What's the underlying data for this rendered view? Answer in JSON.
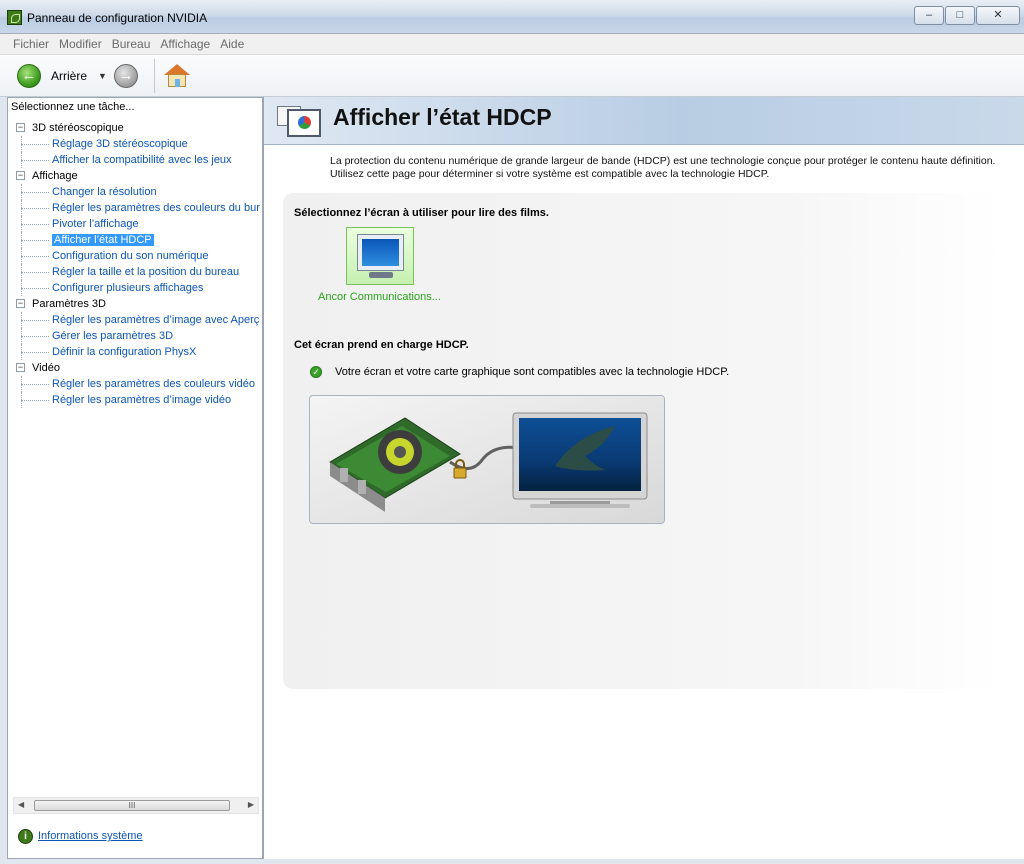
{
  "window": {
    "title": "Panneau de configuration NVIDIA",
    "controls": [
      "–",
      "□",
      "✕"
    ]
  },
  "menu": [
    "Fichier",
    "Modifier",
    "Bureau",
    "Affichage",
    "Aide"
  ],
  "toolbar": {
    "back_label": "Arrière"
  },
  "task_header": "Sélectionnez une tâche...",
  "tree": {
    "categories": [
      {
        "label": "3D stéréoscopique",
        "items": [
          "Réglage 3D stéréoscopique",
          "Afficher la compatibilité avec les jeux"
        ]
      },
      {
        "label": "Affichage",
        "items": [
          "Changer la résolution",
          "Régler les paramètres des couleurs du bure",
          "Pivoter l’affichage",
          "Afficher l’état HDCP",
          "Configuration du son numérique",
          "Régler la taille et la position du bureau",
          "Configurer plusieurs affichages"
        ]
      },
      {
        "label": "Paramètres 3D",
        "items": [
          "Régler les paramètres d’image avec Aperçu",
          "Gérer les paramètres 3D",
          "Définir la configuration PhysX"
        ]
      },
      {
        "label": "Vidéo",
        "items": [
          "Régler les paramètres des couleurs vidéo",
          "Régler les paramètres d’image vidéo"
        ]
      }
    ],
    "selected": "Afficher l’état HDCP"
  },
  "scrollbar": {
    "thumb_grip": "III"
  },
  "system_info_link": "Informations système",
  "page": {
    "title": "Afficher l’état HDCP",
    "intro_line1": "La protection du contenu numérique de grande largeur de bande (HDCP) est une technologie conçue pour protéger le contenu haute définition.",
    "intro_line2": "Utilisez cette page pour déterminer si votre système est compatible avec la technologie HDCP.",
    "select_label": "Sélectionnez l’écran à utiliser pour lire des films.",
    "monitor_name": "Ancor Communications...",
    "hdcp_label": "Cet écran prend en charge HDCP.",
    "compat_message": "Votre écran et votre carte graphique sont compatibles avec la technologie HDCP."
  },
  "colors": {
    "link": "#0b55b4",
    "selection": "#3399ff",
    "status_green": "#2aa21b"
  }
}
